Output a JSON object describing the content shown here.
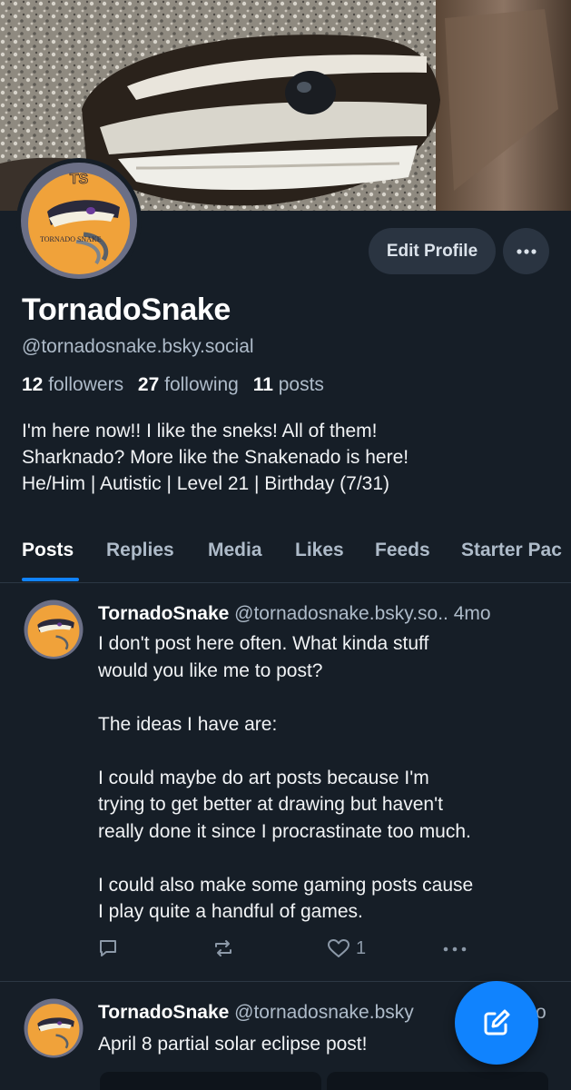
{
  "profile": {
    "avatar_text": "TS",
    "avatar_logo_text": "TORNADO SNAKE",
    "display_name": "TornadoSnake",
    "handle": "@tornadosnake.bsky.social",
    "followers_count": "12",
    "followers_label": "followers",
    "following_count": "27",
    "following_label": "following",
    "posts_count": "11",
    "posts_label": "posts",
    "bio_lines": [
      "I'm here now!! I like the sneks! All of them!",
      "Sharknado? More like the Snakenado is here!",
      "He/Him | Autistic | Level 21 | Birthday (7/31)"
    ]
  },
  "actions": {
    "edit_profile_label": "Edit Profile",
    "more_icon": "ellipsis-icon"
  },
  "tabs": [
    {
      "label": "Posts",
      "active": true
    },
    {
      "label": "Replies",
      "active": false
    },
    {
      "label": "Media",
      "active": false
    },
    {
      "label": "Likes",
      "active": false
    },
    {
      "label": "Feeds",
      "active": false
    },
    {
      "label": "Starter Pac",
      "active": false
    }
  ],
  "posts": [
    {
      "author": "TornadoSnake",
      "handle": "@tornadosnake.bsky.so..",
      "time": "4mo",
      "lines": [
        "I don't post here often. What kinda stuff",
        "would you like me to post?",
        "",
        "The ideas I have are:",
        "",
        "I could maybe do art posts because I'm",
        "trying to get better at drawing but haven't",
        "really done it since I procrastinate too much.",
        "",
        "I could also make some gaming posts cause",
        "I play quite a handful of games."
      ],
      "like_count": "1"
    },
    {
      "author": "TornadoSnake",
      "handle": "@tornadosnake.bsky",
      "time": "o",
      "lines": [
        "April 8 partial solar eclipse post!"
      ]
    }
  ],
  "colors": {
    "background": "#161e27",
    "accent": "#1083fe",
    "button_bg": "#2a3441",
    "muted_text": "#aebbc9",
    "avatar_orange": "#f0a23a",
    "avatar_ring": "#6b6f86"
  }
}
